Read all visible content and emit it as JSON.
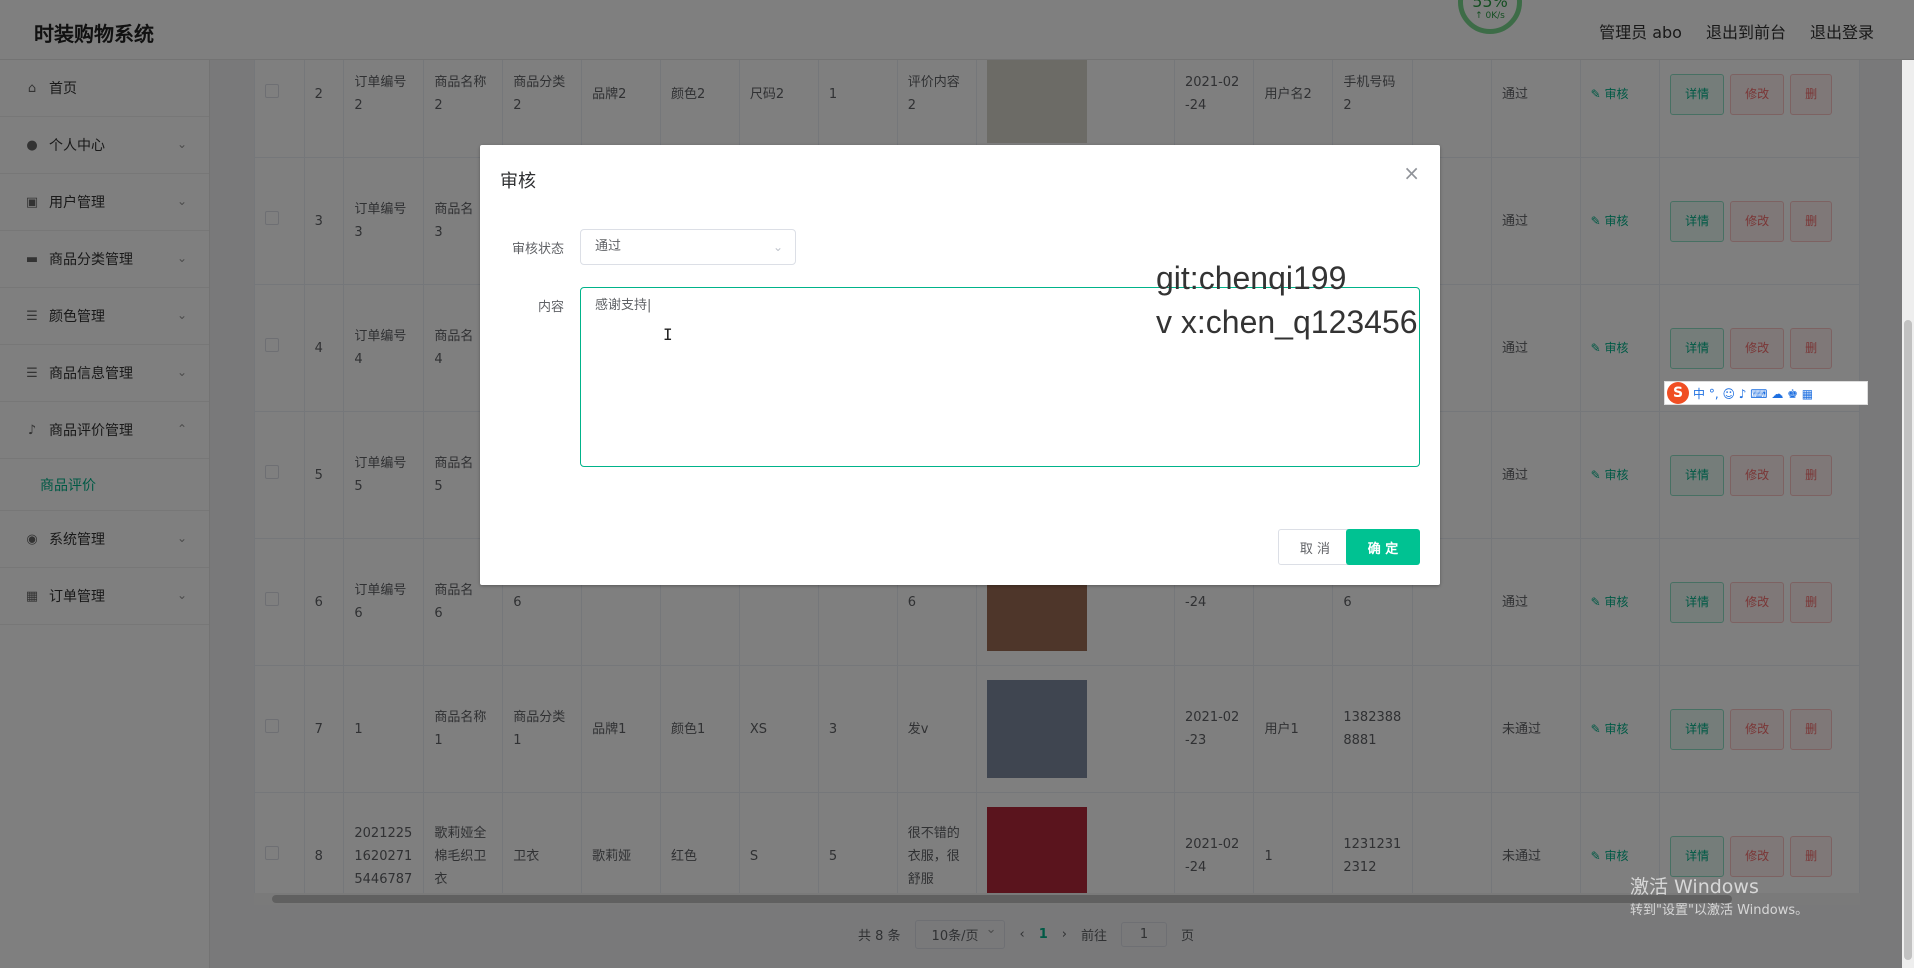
{
  "header": {
    "brand": "时装购物系统",
    "admin": "管理员 abo",
    "to_front": "退出到前台",
    "logout": "退出登录",
    "speed_pct": "55%",
    "speed_rate": "↑ 0K/s"
  },
  "sidebar": {
    "items": [
      {
        "label": "首页",
        "icon": "home-icon"
      },
      {
        "label": "个人中心",
        "icon": "user-icon"
      },
      {
        "label": "用户管理",
        "icon": "clipboard-icon"
      },
      {
        "label": "商品分类管理",
        "icon": "chat-icon"
      },
      {
        "label": "颜色管理",
        "icon": "list-icon"
      },
      {
        "label": "商品信息管理",
        "icon": "list-icon"
      },
      {
        "label": "商品评价管理",
        "icon": "mic-icon"
      },
      {
        "label": "系统管理",
        "icon": "globe-icon"
      },
      {
        "label": "订单管理",
        "icon": "grid-icon"
      }
    ],
    "submenu_active": "商品评价"
  },
  "table": {
    "rows": [
      {
        "idx": "2",
        "order": "订单编号\n2",
        "name": "商品名称\n2",
        "cat": "商品分类\n2",
        "brand": "品牌2",
        "color": "颜色2",
        "size": "尺码2",
        "qty": "1",
        "review": "评价内容\n2",
        "date": "2021-02\n-24",
        "user": "用户名2",
        "phone": "手机号码\n2",
        "status": "通过",
        "img_color": "#d9d6cc"
      },
      {
        "idx": "3",
        "order": "订单编号\n3",
        "name": "商品名\n3",
        "cat": "",
        "brand": "",
        "color": "",
        "size": "",
        "qty": "",
        "review": "",
        "date": "",
        "user": "",
        "phone": "",
        "status": "通过",
        "img_color": "#bfb7ad"
      },
      {
        "idx": "4",
        "order": "订单编号\n4",
        "name": "商品名\n4",
        "cat": "",
        "brand": "",
        "color": "",
        "size": "",
        "qty": "",
        "review": "",
        "date": "",
        "user": "",
        "phone": "",
        "status": "通过",
        "img_color": "#c4b9a8"
      },
      {
        "idx": "5",
        "order": "订单编号\n5",
        "name": "商品名\n5",
        "cat": "",
        "brand": "",
        "color": "",
        "size": "",
        "qty": "",
        "review": "",
        "date": "",
        "user": "",
        "phone": "",
        "status": "通过",
        "img_color": "#b6a99a"
      },
      {
        "idx": "6",
        "order": "订单编号\n6",
        "name": "商品名\n6",
        "cat": "6",
        "brand": "",
        "color": "",
        "size": "",
        "qty": "",
        "review": "6",
        "date": "-24",
        "user": "",
        "phone": "6",
        "status": "通过",
        "img_color": "#9c6c55"
      },
      {
        "idx": "7",
        "order": "1",
        "name": "商品名称\n1",
        "cat": "商品分类\n1",
        "brand": "品牌1",
        "color": "颜色1",
        "size": "XS",
        "qty": "3",
        "review": "发v",
        "date": "2021-02\n-23",
        "user": "用户1",
        "phone": "1382388\n8881",
        "status": "未通过",
        "img_color": "#7e8ba0"
      },
      {
        "idx": "8",
        "order": "2021225\n1620271\n5446787",
        "name": "歌莉娅全\n棉毛织卫\n衣",
        "cat": "卫衣",
        "brand": "歌莉娅",
        "color": "红色",
        "size": "S",
        "qty": "5",
        "review": "很不错的\n衣服，很\n舒服",
        "date": "2021-02\n-24",
        "user": "1",
        "phone": "1231231\n2312",
        "status": "未通过",
        "img_color": "#b5283a"
      }
    ],
    "audit_label": "审核",
    "detail_label": "详情",
    "edit_label": "修改",
    "delete_label": "删"
  },
  "pagination": {
    "total": "共 8 条",
    "page_size": "10条/页",
    "prev": "‹",
    "current": "1",
    "next": "›",
    "goto_label": "前往",
    "goto_value": "1",
    "page_unit": "页"
  },
  "dialog": {
    "title": "审核",
    "close": "×",
    "status_label": "审核状态",
    "status_value": "通过",
    "content_label": "内容",
    "content_value": "感谢支持|",
    "cancel": "取 消",
    "confirm": "确 定"
  },
  "watermark": {
    "line1": "git:chenqi199",
    "line2": "v x:chen_q123456"
  },
  "ime": {
    "logo": "S",
    "icons": "中 °, ☺ ♪ ⌨ ☁ ♚ ▦"
  },
  "windows": {
    "line1": "激活 Windows",
    "line2": "转到\"设置\"以激活 Windows。"
  },
  "colors": {
    "accent": "#00b38a",
    "danger": "#f56c6c",
    "confirm": "#00c292"
  }
}
